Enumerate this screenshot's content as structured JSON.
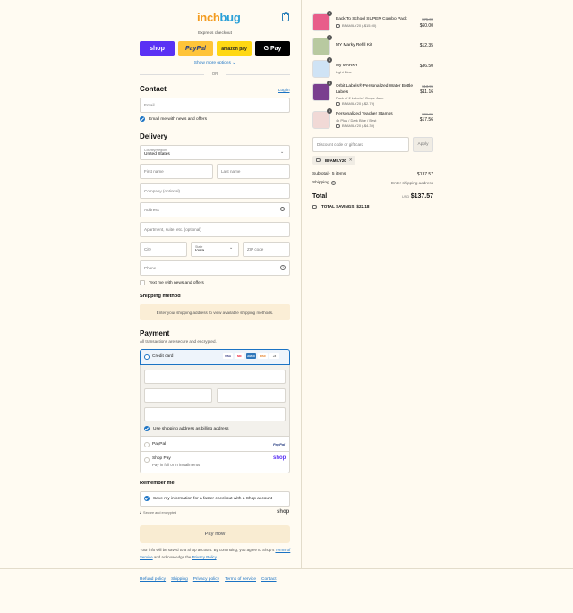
{
  "brand": {
    "logo_a": "inch",
    "logo_b": "bug"
  },
  "express": {
    "title": "Express checkout",
    "buttons": [
      "shop",
      "PayPal",
      "amazon pay",
      "G Pay"
    ],
    "show_more": "Show more options",
    "or": "OR"
  },
  "contact": {
    "title": "Contact",
    "login": "Log in",
    "email_placeholder": "Email",
    "news_label": "Email me with news and offers"
  },
  "delivery": {
    "title": "Delivery",
    "country_label": "Country/Region",
    "country_value": "United States",
    "first_name": "First name",
    "last_name": "Last name",
    "company": "Company (optional)",
    "address": "Address",
    "apartment": "Apartment, suite, etc. (optional)",
    "city": "City",
    "state_label": "State",
    "state_value": "Iowa",
    "zip": "ZIP code",
    "phone": "Phone",
    "text_label": "Text me with news and offers"
  },
  "shipping": {
    "title": "Shipping method",
    "message": "Enter your shipping address to view available shipping methods."
  },
  "payment": {
    "title": "Payment",
    "subtitle": "All transactions are secure and encrypted.",
    "credit_card": "Credit card",
    "card_brands": [
      "VISA",
      "MC",
      "AMEX",
      "DISC",
      "+6"
    ],
    "billing_same": "Use shipping address as billing address",
    "paypal": "PayPal",
    "shoppay": "Shop Pay",
    "shoppay_sub": "Pay in full or in installments",
    "shop_logo": "shop"
  },
  "remember": {
    "title": "Remember me",
    "save_label": "Save my information for a faster checkout with a Shop account",
    "secure": "Secure and encrypted",
    "shop": "shop"
  },
  "pay_now": "Pay now",
  "disclaimer": {
    "text1": "Your info will be saved to a Shop account. By continuing, you agree to Shop's",
    "tos": "Terms of Service",
    "text2": "and acknowledge the",
    "privacy": "Privacy Policy",
    "end": "."
  },
  "footer_links": [
    "Refund policy",
    "Shipping",
    "Privacy policy",
    "Terms of service",
    "Contact"
  ],
  "order": {
    "items": [
      {
        "qty": "1",
        "name": "Back To School SUPER Combo Pack",
        "sub": "",
        "discount": "BFAMILY20 (-$15.00)",
        "old_price": "$75.00",
        "price": "$60.00",
        "color": "#e85d8a"
      },
      {
        "qty": "1",
        "name": "MY Marky Refill Kit",
        "sub": "",
        "discount": "",
        "old_price": "",
        "price": "$12.35",
        "color": "#7a9a5a"
      },
      {
        "qty": "1",
        "name": "My MARKY",
        "sub": "Light Blue",
        "discount": "",
        "old_price": "",
        "price": "$36.50",
        "color": "#7fb4e0"
      },
      {
        "qty": "1",
        "name": "Orbit Labels® Personalized Water Bottle Labels",
        "sub": "Pack of 2 Labels / Grape Jace",
        "discount": "BFAMILY20 (-$2.79)",
        "old_price": "$13.95",
        "price": "$11.16",
        "color": "#7a3f8f"
      },
      {
        "qty": "1",
        "name": "Personalized Teacher Stamps",
        "sub": "4x Plus / Dark Blue / Best",
        "discount": "BFAMILY20 (-$4.39)",
        "old_price": "$21.95",
        "price": "$17.56",
        "color": "#c4524e"
      }
    ],
    "discount_placeholder": "Discount code or gift card",
    "apply": "Apply",
    "applied_code": "BFAMILY20",
    "subtotal_label": "Subtotal · 5 items",
    "subtotal": "$137.57",
    "shipping_label": "Shipping",
    "shipping_value": "Enter shipping address",
    "total_label": "Total",
    "currency": "USD",
    "total": "$137.57",
    "savings_label": "TOTAL SAVINGS",
    "savings": "$22.18"
  }
}
